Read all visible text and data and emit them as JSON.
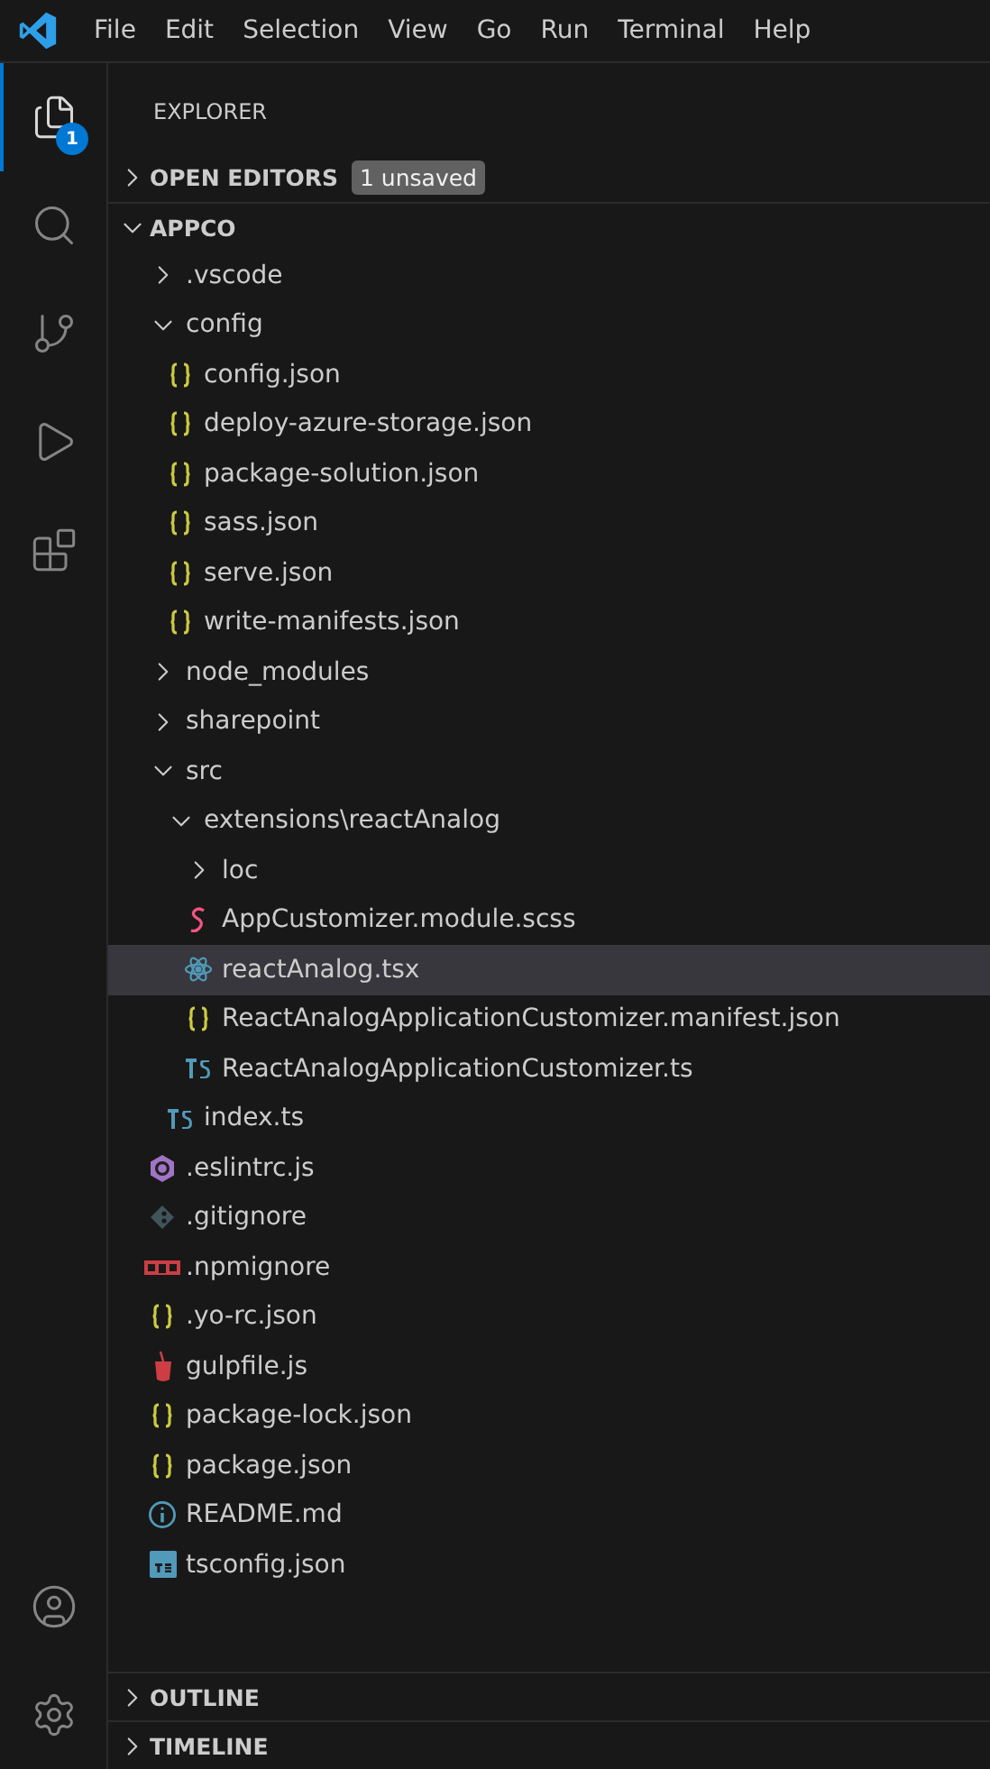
{
  "menu": [
    "File",
    "Edit",
    "Selection",
    "View",
    "Go",
    "Run",
    "Terminal",
    "Help"
  ],
  "activity_bar": [
    {
      "kind": "explorer",
      "selected": true,
      "badge": "1"
    },
    {
      "kind": "search",
      "selected": false
    },
    {
      "kind": "source_control",
      "selected": false
    },
    {
      "kind": "run_debug",
      "selected": false
    },
    {
      "kind": "extensions",
      "selected": false
    }
  ],
  "activity_bar_bottom": [
    {
      "kind": "accounts"
    },
    {
      "kind": "settings"
    }
  ],
  "sidebar": {
    "title": "EXPLORER",
    "open_editors": {
      "label": "OPEN EDITORS",
      "expanded": false,
      "badge": "1 unsaved"
    },
    "workspace": {
      "label": "APPCO",
      "expanded": true
    },
    "tree": [
      {
        "kind": "folder",
        "label": ".vscode",
        "expanded": false,
        "selected": false
      },
      {
        "kind": "folder",
        "label": "config",
        "expanded": true,
        "selected": false,
        "children": [
          {
            "kind": "json",
            "label": "config.json",
            "selected": false
          },
          {
            "kind": "json",
            "label": "deploy-azure-storage.json",
            "selected": false
          },
          {
            "kind": "json",
            "label": "package-solution.json",
            "selected": false
          },
          {
            "kind": "json",
            "label": "sass.json",
            "selected": false
          },
          {
            "kind": "json",
            "label": "serve.json",
            "selected": false
          },
          {
            "kind": "json",
            "label": "write-manifests.json",
            "selected": false
          }
        ]
      },
      {
        "kind": "folder",
        "label": "node_modules",
        "expanded": false,
        "selected": false
      },
      {
        "kind": "folder",
        "label": "sharepoint",
        "expanded": false,
        "selected": false
      },
      {
        "kind": "folder",
        "label": "src",
        "expanded": true,
        "selected": false,
        "children": [
          {
            "kind": "folder",
            "label": "extensions\\reactAnalog",
            "expanded": true,
            "selected": false,
            "children": [
              {
                "kind": "folder",
                "label": "loc",
                "expanded": false,
                "selected": false
              },
              {
                "kind": "scss",
                "label": "AppCustomizer.module.scss",
                "selected": false
              },
              {
                "kind": "react",
                "label": "reactAnalog.tsx",
                "selected": true
              },
              {
                "kind": "json",
                "label": "ReactAnalogApplicationCustomizer.manifest.json",
                "selected": false
              },
              {
                "kind": "ts",
                "label": "ReactAnalogApplicationCustomizer.ts",
                "selected": false
              }
            ]
          },
          {
            "kind": "ts",
            "label": "index.ts",
            "selected": false
          }
        ]
      },
      {
        "kind": "eslint",
        "label": ".eslintrc.js",
        "selected": false
      },
      {
        "kind": "git",
        "label": ".gitignore",
        "selected": false
      },
      {
        "kind": "npm",
        "label": ".npmignore",
        "selected": false
      },
      {
        "kind": "json",
        "label": ".yo-rc.json",
        "selected": false
      },
      {
        "kind": "gulp",
        "label": "gulpfile.js",
        "selected": false
      },
      {
        "kind": "json",
        "label": "package-lock.json",
        "selected": false
      },
      {
        "kind": "json",
        "label": "package.json",
        "selected": false
      },
      {
        "kind": "info",
        "label": "README.md",
        "selected": false
      },
      {
        "kind": "tsconfig",
        "label": "tsconfig.json",
        "selected": false
      }
    ],
    "panels": [
      {
        "label": "OUTLINE",
        "expanded": false
      },
      {
        "label": "TIMELINE",
        "expanded": false
      }
    ]
  }
}
